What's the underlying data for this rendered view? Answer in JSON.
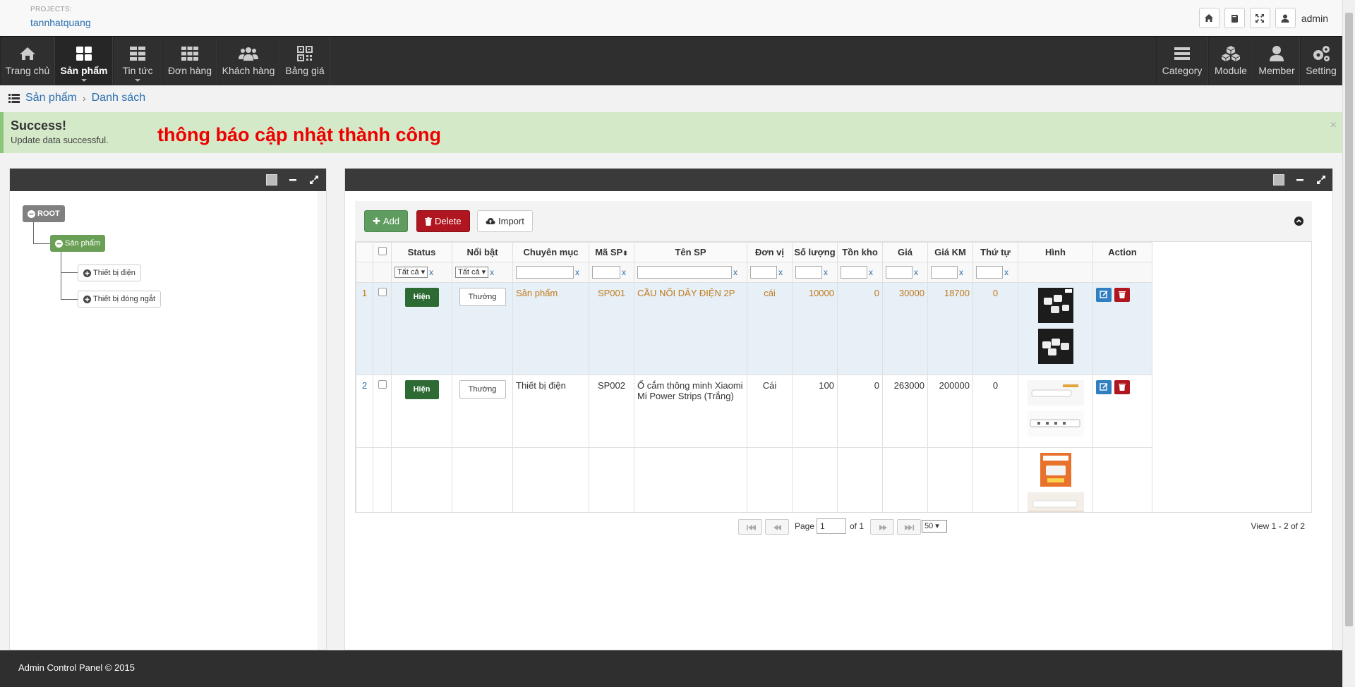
{
  "project": {
    "label": "PROJECTS:",
    "name": "tannhatquang"
  },
  "user": {
    "name": "admin"
  },
  "nav": {
    "left": [
      {
        "label": "Trang chủ",
        "icon": "home-icon"
      },
      {
        "label": "Sản phẩm",
        "icon": "grid-large-icon",
        "active": true
      },
      {
        "label": "Tin tức",
        "icon": "grid-icon"
      },
      {
        "label": "Đơn hàng",
        "icon": "grid-small-icon"
      },
      {
        "label": "Khách hàng",
        "icon": "users-icon"
      },
      {
        "label": "Bảng giá",
        "icon": "qrcode-icon"
      }
    ],
    "right": [
      {
        "label": "Category",
        "icon": "list-icon"
      },
      {
        "label": "Module",
        "icon": "cubes-icon"
      },
      {
        "label": "Member",
        "icon": "user-icon"
      },
      {
        "label": "Setting",
        "icon": "gears-icon"
      }
    ]
  },
  "breadcrumb": {
    "first": "Sản phẩm",
    "second": "Danh sách"
  },
  "alert": {
    "title": "Success!",
    "message": "Update data successful.",
    "note": "thông báo cập nhật thành công",
    "close": "×"
  },
  "tree": {
    "root": "ROOT",
    "level1": "Sản phẩm",
    "children": [
      "Thiết bị điện",
      "Thiết bị đóng ngắt"
    ]
  },
  "toolbar": {
    "add": "Add",
    "delete": "Delete",
    "import": "Import"
  },
  "columns": [
    "Status",
    "Nổi bật",
    "Chuyên mục",
    "Mã SP",
    "Tên SP",
    "Đơn vị",
    "Số lượng",
    "Tồn kho",
    "Giá",
    "Giá KM",
    "Thứ tự",
    "Hình",
    "Action"
  ],
  "filter": {
    "all": "Tất cả",
    "clear": "x"
  },
  "rows": [
    {
      "no": "1",
      "status": "Hiện",
      "featured": "Thường",
      "category": "Sản phẩm",
      "code": "SP001",
      "name": "CẦU NỐI DÂY ĐIỆN 2P",
      "unit": "cái",
      "qty": "10000",
      "stock": "0",
      "price": "30000",
      "sale": "18700",
      "order": "0"
    },
    {
      "no": "2",
      "status": "Hiện",
      "featured": "Thường",
      "category": "Thiết bị điện",
      "code": "SP002",
      "name": "Ổ cắm thông minh Xiaomi Mi Power Strips (Trắng)",
      "unit": "Cái",
      "qty": "100",
      "stock": "0",
      "price": "263000",
      "sale": "200000",
      "order": "0"
    }
  ],
  "pager": {
    "page_label": "Page",
    "page": "1",
    "of": "of 1",
    "per_page": "50",
    "view": "View 1 - 2 of 2"
  },
  "footer": "Admin Control Panel © 2015"
}
